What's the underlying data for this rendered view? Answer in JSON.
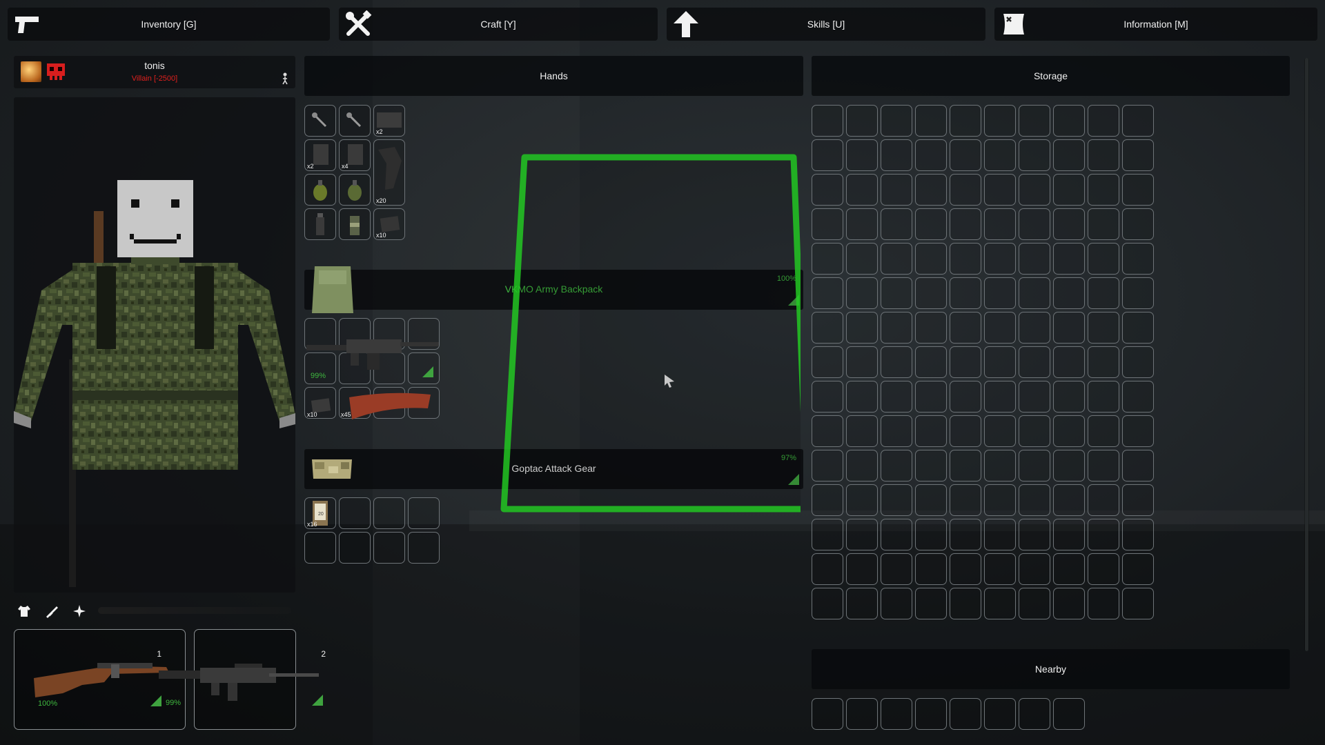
{
  "tabs": [
    {
      "label": "Inventory [G]",
      "icon": "pistol-icon"
    },
    {
      "label": "Craft [Y]",
      "icon": "tools-icon"
    },
    {
      "label": "Skills [U]",
      "icon": "arrow-up-icon"
    },
    {
      "label": "Information [M]",
      "icon": "map-icon"
    }
  ],
  "player": {
    "name": "tonis",
    "reputation": "Villain [-2500]",
    "reputation_color": "#e0201e"
  },
  "sections": {
    "hands": "Hands",
    "storage": "Storage",
    "nearby": "Nearby"
  },
  "hands_items": [
    {
      "qty": ""
    },
    {
      "qty": ""
    },
    {
      "qty": "x2"
    },
    {
      "qty": "x2"
    },
    {
      "qty": "x4"
    },
    {
      "qty": ""
    },
    {
      "qty": ""
    },
    {
      "qty": ""
    },
    {
      "qty": "x20"
    },
    {
      "qty": ""
    },
    {
      "qty": ""
    },
    {
      "qty": "x10"
    }
  ],
  "backpack": {
    "name": "VKMO Army Backpack",
    "durability": "100%",
    "name_color": "#3fb83f",
    "contents": {
      "gun_durability": "99%",
      "mag1_qty": "x10",
      "mag2_qty": "x45"
    }
  },
  "vest": {
    "name": "Goptac Attack Gear",
    "durability": "97%",
    "contents": {
      "box_qty": "x16",
      "box_label": "20"
    }
  },
  "weapons": [
    {
      "slot": "1",
      "durability": "100%"
    },
    {
      "slot": "2",
      "durability": "99%"
    }
  ],
  "character_tabs": [
    "shirt-icon",
    "rifle-icon",
    "sparkle-icon"
  ],
  "colors": {
    "accent_green": "#3fb83f",
    "highlight_green": "#22c622",
    "villain_red": "#e0201e"
  }
}
